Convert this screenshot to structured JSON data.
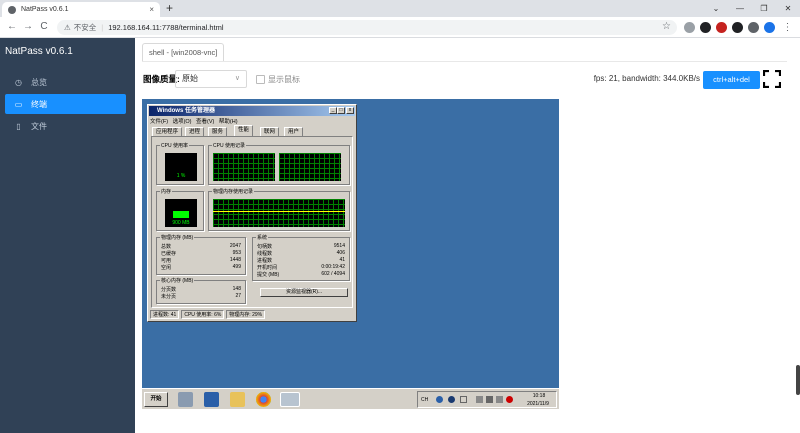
{
  "browser": {
    "tab_title": "NatPass v0.6.1",
    "close_symbol": "×",
    "new_tab_symbol": "+",
    "security_text": "不安全",
    "url": "192.168.164.11:7788/terminal.html",
    "window_controls": [
      "⌄",
      "—",
      "❐",
      "✕"
    ],
    "nav": [
      "←",
      "→",
      "C"
    ]
  },
  "sidebar": {
    "brand": "NatPass v0.6.1",
    "items": [
      {
        "label": "总览",
        "icon": "clock-icon"
      },
      {
        "label": "终端",
        "icon": "monitor-icon",
        "active": true
      },
      {
        "label": "文件",
        "icon": "file-icon"
      }
    ]
  },
  "page_tabs": [
    {
      "label": "shell - [win2008-vnc]"
    }
  ],
  "toolbar": {
    "quality_label": "图像质量:",
    "quality_value": "原始",
    "show_cursor_label": "显示鼠标",
    "show_cursor_checked": false,
    "stats": "fps: 21, bandwidth: 344.0KB/s",
    "cad_button": "ctrl+alt+del"
  },
  "remote": {
    "window_title": "Windows 任务管理器",
    "menu": [
      "文件(F)",
      "选项(O)",
      "查看(V)",
      "帮助(H)"
    ],
    "tabs": [
      "应用程序",
      "进程",
      "服务",
      "性能",
      "联网",
      "用户"
    ],
    "selected_tab": "性能",
    "groups": {
      "cpu": "CPU 使用率",
      "cpu_hist": "CPU 使用记录",
      "mem": "内存",
      "mem_hist": "物理内存使用记录",
      "phys": "物理内存 (MB)",
      "kernel": "核心内存 (MB)",
      "system": "系统"
    },
    "cpu_value": "1 %",
    "mem_value": "900 MB",
    "phys_rows": [
      [
        "总数",
        "2047"
      ],
      [
        "已缓存",
        "953"
      ],
      [
        "可用",
        "1448"
      ],
      [
        "空闲",
        "499"
      ]
    ],
    "kernel_rows": [
      [
        "分页数",
        "148"
      ],
      [
        "未分页",
        "27"
      ]
    ],
    "system_rows": [
      [
        "句柄数",
        "9514"
      ],
      [
        "线程数",
        "406"
      ],
      [
        "进程数",
        "41"
      ],
      [
        "开机时间",
        "0:00:19:42"
      ],
      [
        "提交 (MB)",
        "602 / 4094"
      ]
    ],
    "monitor_button": "资源监视器(R)...",
    "status": [
      "进程数: 41",
      "CPU 使用率: 6%",
      "物理内存: 29%"
    ],
    "start_label": "开始",
    "tray_lang": "CH",
    "clock_time": "10:18",
    "clock_date": "2021/11/9"
  }
}
